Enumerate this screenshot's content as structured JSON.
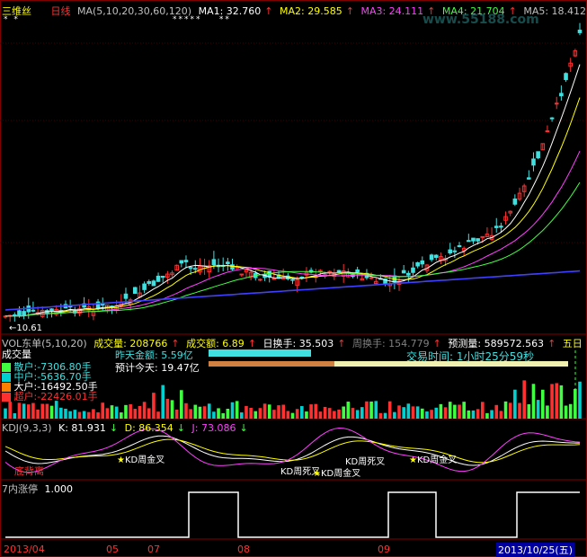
{
  "colors": {
    "bg": "#000000",
    "frame": "#800000",
    "up": "#ff3030",
    "down": "#40e0e0",
    "white": "#ffffff",
    "yellow": "#ffff00",
    "magenta": "#ff40ff",
    "green": "#40ff40",
    "blue": "#4040ff",
    "teal": "#00d0d0",
    "label": "#c0c0c0"
  },
  "top": {
    "title": "三维丝",
    "period": "日线",
    "ma_spec": "MA(5,10,20,30,60,120)",
    "ma1": "MA1: 32.760",
    "ma2": "MA2: 29.585",
    "ma3": "MA3: 24.111",
    "ma4": "MA4: 21.704",
    "ma5": "MA5: 18.412",
    "watermark": "www.55188.com",
    "low_price": "←10.61"
  },
  "vol": {
    "spec": "VOL东单(5,10,20)",
    "vol_label": "成交量: 208766",
    "amount_label": "成交额: 6.89",
    "turnover_label": "日换手: 35.503",
    "week_turnover": "周换手: 154.779",
    "pred_vol": "预测量: 589572.563",
    "five_day": "五日",
    "panel_title": "成交量",
    "yesterday_label": "昨天金额: 5.59亿",
    "forecast_label": "预计今天: 19.47亿",
    "trade_time": "交易时间: 1小时25分59秒",
    "sanhu": "散户:-7306.80手",
    "zhonghu": "中户:-5636.70手",
    "dahu": "大户:-16492.50手",
    "chaohu": "超户:-22426.01手"
  },
  "kdj": {
    "spec": "KDJ(9,3,3)",
    "k": "K: 81.931",
    "d": "D: 86.354",
    "j": "J: 73.086",
    "bottom_div": "底背离",
    "signals": [
      "KD周金叉",
      "KD周死叉",
      "KD周金叉",
      "KD周死叉",
      "KD周金叉"
    ]
  },
  "limit": {
    "spec": "7内涨停",
    "value": "1.000",
    "levels": [
      0,
      1,
      0,
      1,
      0,
      1
    ],
    "switch_x": [
      210,
      265,
      432,
      485,
      575
    ]
  },
  "axis": {
    "labels": [
      "2013/04",
      "05",
      "07",
      "08",
      "09"
    ],
    "current_date": "2013/10/25(五)"
  }
}
